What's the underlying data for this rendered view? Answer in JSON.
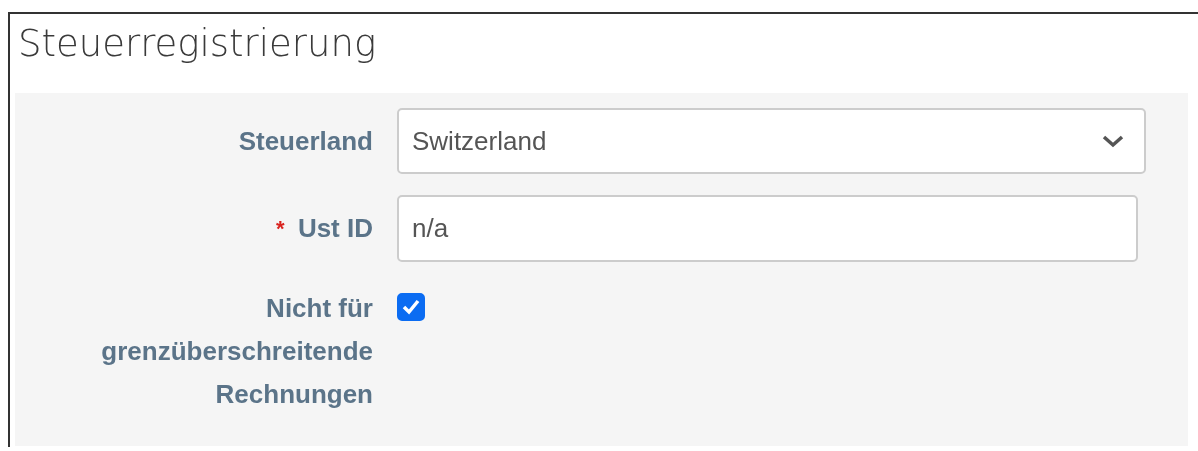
{
  "title": "Steuerregistrierung",
  "fields": [
    {
      "kind": "select",
      "label": "Steuerland",
      "value": "Switzerland"
    },
    {
      "kind": "text",
      "label": "Ust ID",
      "required_mark": "*",
      "value": "n/a"
    },
    {
      "kind": "checkbox",
      "label": "Nicht für grenzüberschreitende Rechnungen",
      "checked": true
    }
  ]
}
